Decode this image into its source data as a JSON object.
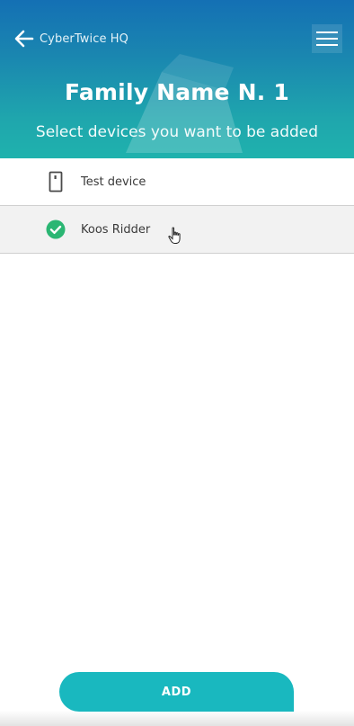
{
  "header": {
    "back_label": "CyberTwice HQ",
    "back_icon": "arrow-left-icon",
    "menu_icon": "hamburger-menu-icon",
    "title": "Family Name N. 1",
    "subtitle": "Select devices you want to be added",
    "gradient_colors": [
      "#1470b4",
      "#1fb2ad"
    ]
  },
  "devices": [
    {
      "label": "Test device",
      "icon": "phone-device-icon",
      "selected": false
    },
    {
      "label": "Koos Ridder",
      "icon": "check-circle-icon",
      "selected": true
    }
  ],
  "actions": {
    "add_label": "ADD",
    "accent_color": "#19b8bf"
  },
  "colors": {
    "selected_check": "#2bb673",
    "row_selected_bg": "#f2f2f2"
  }
}
